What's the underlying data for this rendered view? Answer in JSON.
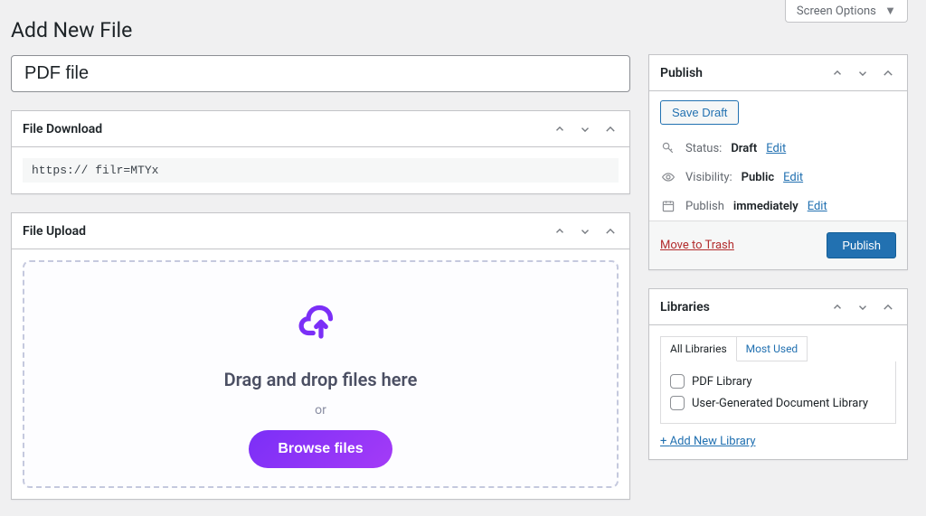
{
  "screen_options_label": "Screen Options",
  "page_title": "Add New File",
  "title_value": "PDF file",
  "file_download": {
    "heading": "File Download",
    "url": "https://                    filr=MTYx"
  },
  "file_upload": {
    "heading": "File Upload",
    "drop_text": "Drag and drop files here",
    "or_text": "or",
    "browse_label": "Browse files"
  },
  "publish": {
    "heading": "Publish",
    "save_draft": "Save Draft",
    "status_label": "Status:",
    "status_value": "Draft",
    "visibility_label": "Visibility:",
    "visibility_value": "Public",
    "publish_on_label": "Publish",
    "publish_on_value": "immediately",
    "edit_link": "Edit",
    "trash_label": "Move to Trash",
    "publish_btn": "Publish"
  },
  "libraries": {
    "heading": "Libraries",
    "tab_all": "All Libraries",
    "tab_most": "Most Used",
    "items": [
      {
        "label": "PDF Library"
      },
      {
        "label": "User-Generated Document Library"
      }
    ],
    "add_new": "Add New Library"
  }
}
